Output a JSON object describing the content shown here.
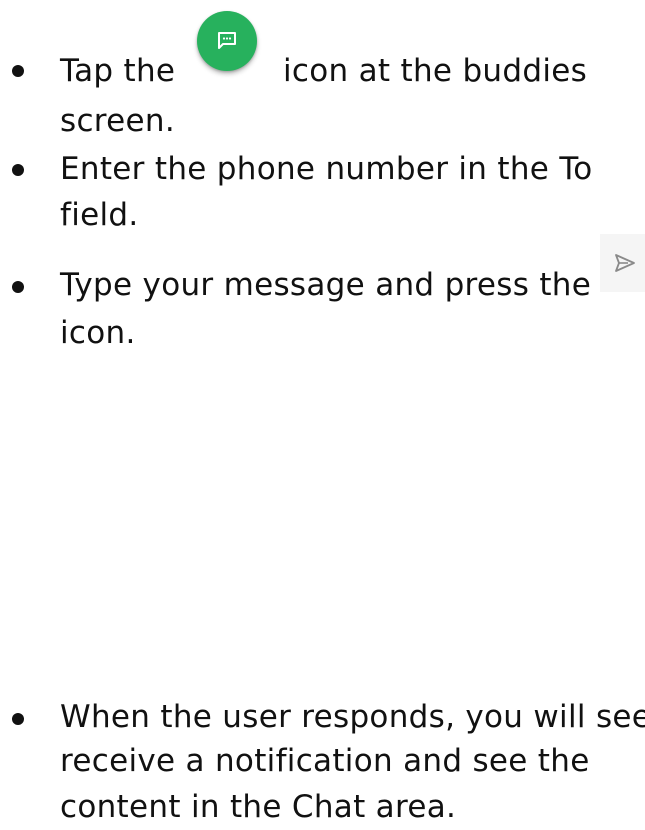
{
  "steps": [
    {
      "lines": [
        "Tap the",
        "icon at the buddies",
        "screen."
      ]
    },
    {
      "lines": [
        "Enter the phone number in the To",
        "field."
      ]
    },
    {
      "lines": [
        "Type your message and press the",
        "icon."
      ]
    },
    {
      "lines": [
        "When the user responds, you will see",
        "receive a notification and see the",
        "content in the Chat area."
      ]
    }
  ],
  "icons": {
    "new_chat": "chat-bubble-icon",
    "new_chat_color": "#27b15d",
    "send": "send-icon"
  }
}
